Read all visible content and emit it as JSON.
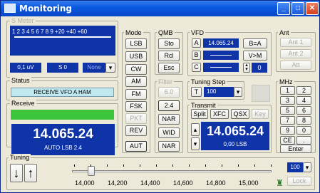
{
  "window": {
    "title": "Monitoring"
  },
  "meter": {
    "label": "S Meter",
    "scale": "1 2 3 4 5 6 7 8 9  +20  +40  +60",
    "readout_left": "0,1 uV",
    "readout_mid": "S 0",
    "select_value": "None"
  },
  "status": {
    "label": "Status",
    "text": "RECEIVE VFO A HAM"
  },
  "receive": {
    "label": "Receive",
    "frequency": "14.065.24",
    "sub": "AUTO LSB 2.4"
  },
  "mode": {
    "label": "Mode",
    "buttons": [
      "LSB",
      "USB",
      "CW",
      "AM",
      "FM",
      "FSK",
      "PKT",
      "REV",
      "AUT"
    ]
  },
  "qmb": {
    "label": "QMB",
    "buttons": [
      "Sto",
      "Rcl",
      "Esc"
    ]
  },
  "filter": {
    "label": "Filter",
    "buttons": [
      "6.0",
      "2.4",
      "NAR",
      "WID",
      "NAR"
    ]
  },
  "vfo": {
    "label": "VFD",
    "a_key": "A",
    "a_freq": "14.065.24",
    "b_key": "B",
    "c_key": "C",
    "btn_ab": "B=A",
    "btn_vm": "V>M",
    "step_value": "0"
  },
  "tuning_step": {
    "label": "Tuning Step",
    "key": "T",
    "value": "100"
  },
  "transmit": {
    "label": "Transmit",
    "buttons": [
      "Split",
      "XFC",
      "QSX",
      "Key"
    ],
    "frequency": "14.065.24",
    "sub": "0,00 LSB"
  },
  "ant": {
    "label": "Ant",
    "buttons": [
      "Ant 1",
      "Ant 2",
      "Att"
    ]
  },
  "mhz": {
    "label": "MHz",
    "keys": [
      "1",
      "2",
      "3",
      "4",
      "5",
      "6",
      "7",
      "8",
      "9",
      "0",
      "CE",
      "."
    ],
    "enter": "Enter"
  },
  "tuning": {
    "label": "Tuning",
    "scale": [
      "14,000",
      "14,200",
      "14,400",
      "14,600",
      "14,800",
      "15,000"
    ],
    "step_select": "100",
    "lock": "Lock",
    "slider_fraction": 0.08
  },
  "colors": {
    "lcd": "#0f34a8",
    "status_bg": "#bfe8f0",
    "receive_bar": "#3cc63c"
  }
}
